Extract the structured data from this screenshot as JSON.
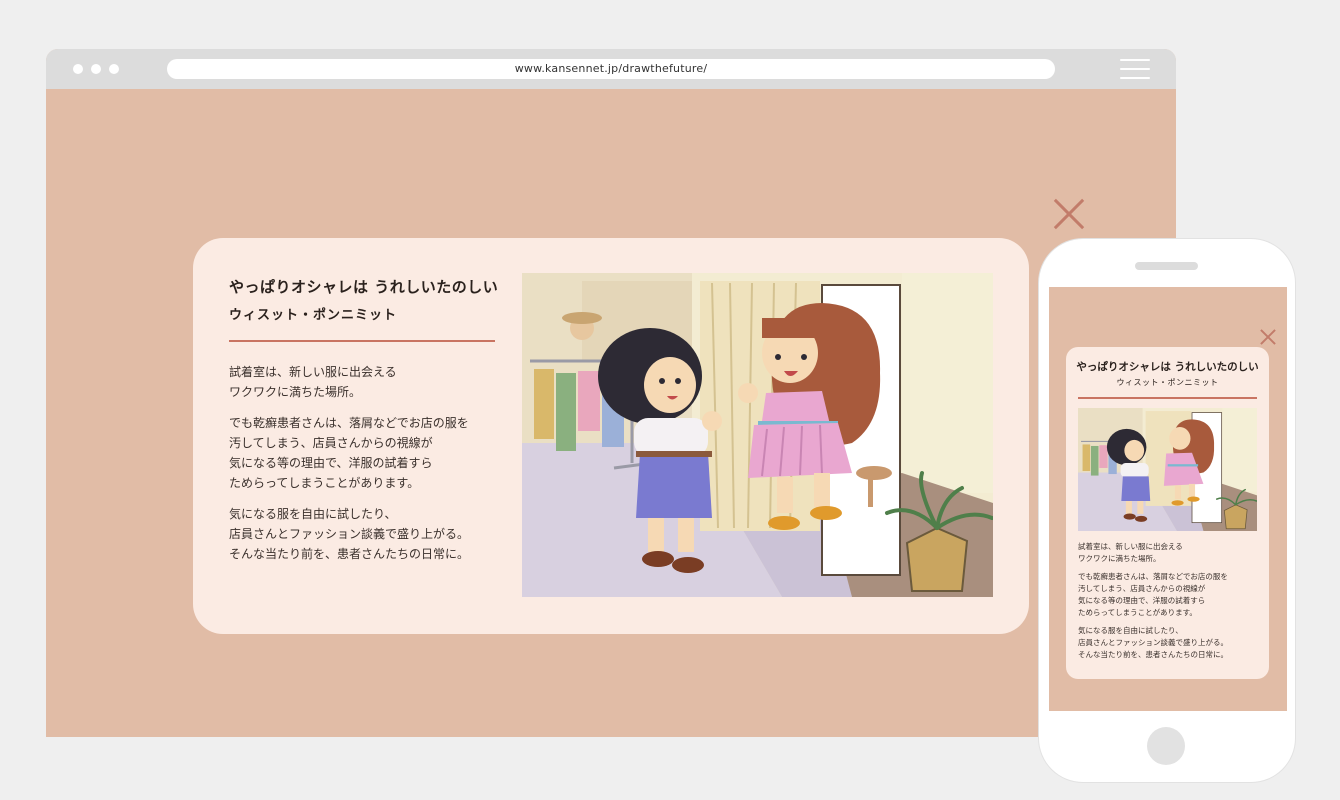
{
  "browser": {
    "url": "www.kansennet.jp/drawthefuture/"
  },
  "story": {
    "title": "やっぱりオシャレは うれしいたのしい",
    "author": "ウィスット・ポンニミット",
    "paragraphs": [
      "試着室は、新しい服に出会える\nワクワクに満ちた場所。",
      "でも乾癬患者さんは、落屑などでお店の服を\n汚してしまう、店員さんからの視線が\n気になる等の理由で、洋服の試着すら\nためらってしまうことがあります。",
      "気になる服を自由に試したり、\n店員さんとファッション談義で盛り上がる。\nそんな当たり前を、患者さんたちの日常に。"
    ]
  },
  "colors": {
    "page_bg": "#efefef",
    "screen_bg": "#e1bca6",
    "card_bg": "#fbebe3",
    "accent": "#c97462",
    "close": "#c27c6a"
  },
  "icons": [
    "close-icon",
    "menu-icon",
    "window-dots-icon"
  ]
}
